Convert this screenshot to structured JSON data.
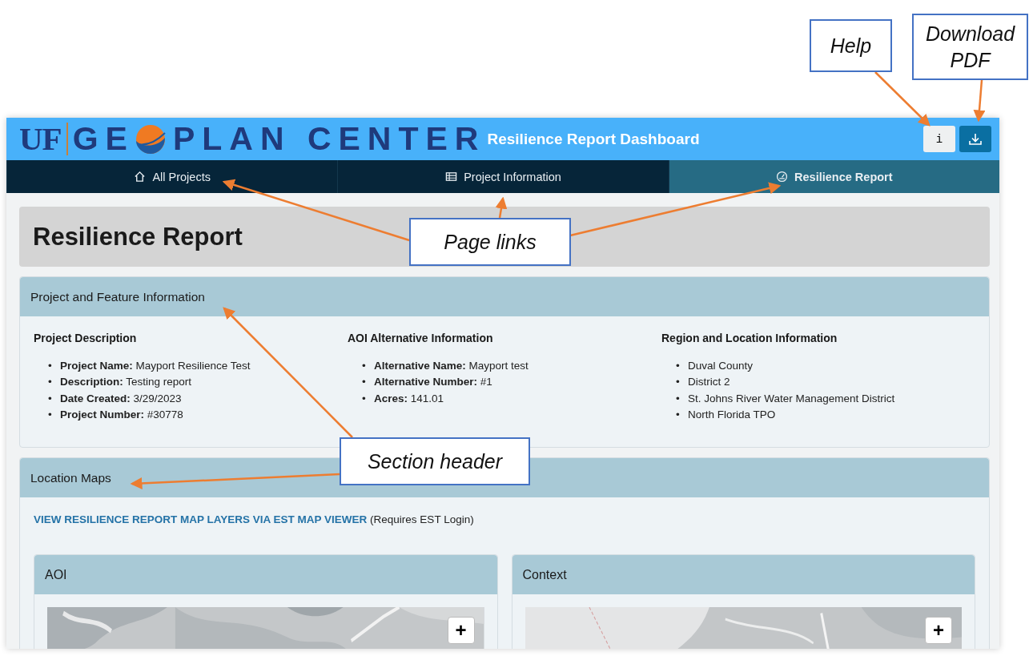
{
  "header": {
    "logo": {
      "mark": "UF",
      "word_start": "GE",
      "word_end": "PLAN CENTER"
    },
    "title": "Resilience Report Dashboard",
    "help_button": "i"
  },
  "tabs": [
    {
      "label": "All Projects",
      "selected": false
    },
    {
      "label": "Project Information",
      "selected": false
    },
    {
      "label": "Resilience Report",
      "selected": true
    }
  ],
  "page_title": "Resilience Report",
  "feature_section": {
    "header": "Project and Feature Information",
    "columns": [
      {
        "heading": "Project Description",
        "items": [
          {
            "marker": "•",
            "label": "Project Name:",
            "value": "Mayport Resilience Test"
          },
          {
            "marker": "•",
            "label": "Description:",
            "value": "Testing report"
          },
          {
            "marker": "•",
            "label": "Date Created:",
            "value": "3/29/2023"
          },
          {
            "marker": "•",
            "label": "Project Number:",
            "value": "#30778"
          }
        ]
      },
      {
        "heading": "AOI Alternative Information",
        "items": [
          {
            "marker": "•",
            "label": "Alternative Name:",
            "value": "Mayport test"
          },
          {
            "marker": "•",
            "label": "Alternative Number:",
            "value": "#1"
          },
          {
            "marker": "•",
            "label": "Acres:",
            "value": "141.01"
          }
        ]
      },
      {
        "heading": "Region and Location Information",
        "items": [
          {
            "marker": "•",
            "value": "Duval County"
          },
          {
            "marker": "•",
            "value": "District 2"
          },
          {
            "marker": "•",
            "value": "St. Johns River Water Management District"
          },
          {
            "marker": "•",
            "value": "North Florida TPO"
          }
        ]
      }
    ]
  },
  "maps_section": {
    "header": "Location Maps",
    "link": "VIEW RESILIENCE REPORT MAP LAYERS VIA EST MAP VIEWER",
    "link_note": "(Requires EST Login)",
    "maps": [
      {
        "title": "AOI",
        "zoom_button": "+"
      },
      {
        "title": "Context",
        "zoom_button": "+"
      }
    ]
  },
  "callouts": [
    {
      "text": "Help"
    },
    {
      "text": "Download PDF"
    },
    {
      "text": "Page links"
    },
    {
      "text": "Section header"
    }
  ]
}
